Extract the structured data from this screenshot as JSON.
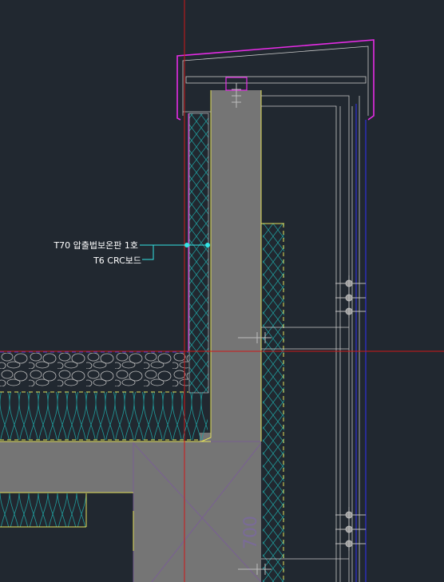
{
  "drawing": {
    "labels": {
      "insulation": "T70 압출법보온판 1호",
      "board": "T6 CRC보드"
    },
    "dimension_text": "700"
  },
  "colors": {
    "background": "#212830",
    "concrete": "#757575",
    "insulation_hatch": "#1f9a9a",
    "outline_yellow": "#e3e05a",
    "crosshair_red": "#d01818",
    "parapet_magenta": "#e52ce5",
    "leader_cyan": "#33e5e5",
    "blue_line": "#2f2fd8",
    "white_line": "#c8c8c8",
    "purple_line": "#7a5a9a"
  },
  "icons": {
    "anchor": "anchor-bolt-icon",
    "bracket": "curtain-wall-bracket-icon"
  }
}
